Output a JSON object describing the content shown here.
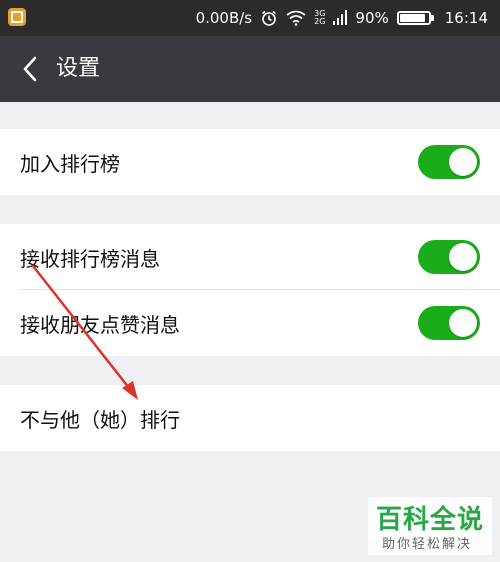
{
  "status_bar": {
    "network_speed": "0.00B/s",
    "signal_top": "3G",
    "signal_bottom": "2G",
    "battery_percent_text": "90%",
    "battery_level": 0.9,
    "time": "16:14",
    "icons": [
      "app-notification-icon",
      "alarm-icon",
      "wifi-icon",
      "signal-icon",
      "battery-icon"
    ]
  },
  "nav": {
    "back_icon": "chevron-left-icon",
    "title": "设置"
  },
  "groups": [
    {
      "rows": [
        {
          "label": "加入排行榜",
          "toggle_on": true
        }
      ]
    },
    {
      "rows": [
        {
          "label": "接收排行榜消息",
          "toggle_on": true
        },
        {
          "label": "接收朋友点赞消息",
          "toggle_on": true
        }
      ]
    },
    {
      "rows": [
        {
          "label": "不与他（她）排行"
        }
      ]
    }
  ],
  "colors": {
    "status_bar": "#2b2b2b",
    "nav_bar": "#393a3f",
    "background": "#efeff4",
    "toggle_on": "#1aad19",
    "annotation_arrow": "#e0322b"
  },
  "watermark": {
    "main": "百科全说",
    "sub": "助你轻松解决"
  }
}
